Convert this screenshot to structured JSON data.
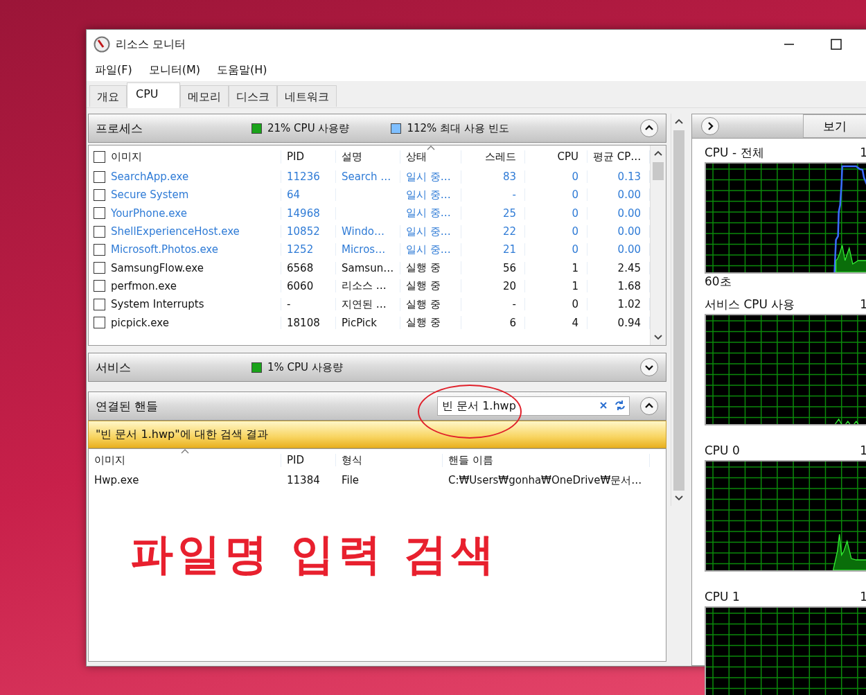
{
  "window": {
    "title": "리소스 모니터"
  },
  "menu": [
    "파일(F)",
    "모니터(M)",
    "도움말(H)"
  ],
  "tabs": [
    {
      "label": "개요",
      "selected": false
    },
    {
      "label": "CPU",
      "selected": true
    },
    {
      "label": "메모리",
      "selected": false
    },
    {
      "label": "디스크",
      "selected": false
    },
    {
      "label": "네트워크",
      "selected": false
    }
  ],
  "processes": {
    "title": "프로세스",
    "expanded": true,
    "legend": [
      {
        "text": "21% CPU 사용량",
        "color": "#1aa31a"
      },
      {
        "text": "112% 최대 사용 빈도",
        "color": "#7fbfff"
      }
    ],
    "columns": [
      "이미지",
      "PID",
      "설명",
      "상태",
      "스레드",
      "CPU",
      "평균 CP…"
    ],
    "all_checked": false,
    "rows": [
      {
        "cells": [
          "SearchApp.exe",
          "11236",
          "Search …",
          "일시 중…",
          "83",
          "0",
          "0.13"
        ],
        "suspended": true,
        "checked": false
      },
      {
        "cells": [
          "Secure System",
          "64",
          "",
          "일시 중…",
          "-",
          "0",
          "0.00"
        ],
        "suspended": true,
        "checked": false
      },
      {
        "cells": [
          "YourPhone.exe",
          "14968",
          "",
          "일시 중…",
          "25",
          "0",
          "0.00"
        ],
        "suspended": true,
        "checked": false
      },
      {
        "cells": [
          "ShellExperienceHost.exe",
          "10852",
          "Windo…",
          "일시 중…",
          "22",
          "0",
          "0.00"
        ],
        "suspended": true,
        "checked": false
      },
      {
        "cells": [
          "Microsoft.Photos.exe",
          "1252",
          "Micros…",
          "일시 중…",
          "21",
          "0",
          "0.00"
        ],
        "suspended": true,
        "checked": false
      },
      {
        "cells": [
          "SamsungFlow.exe",
          "6568",
          "Samsun…",
          "실행 중",
          "56",
          "1",
          "2.45"
        ],
        "suspended": false,
        "checked": false
      },
      {
        "cells": [
          "perfmon.exe",
          "6060",
          "리소스 …",
          "실행 중",
          "20",
          "1",
          "1.68"
        ],
        "suspended": false,
        "checked": false
      },
      {
        "cells": [
          "System Interrupts",
          "-",
          "지연된 …",
          "실행 중",
          "-",
          "0",
          "1.02"
        ],
        "suspended": false,
        "checked": false
      },
      {
        "cells": [
          "picpick.exe",
          "18108",
          "PicPick",
          "실행 중",
          "6",
          "4",
          "0.94"
        ],
        "suspended": false,
        "checked": false
      }
    ]
  },
  "services": {
    "title": "서비스",
    "expanded": false,
    "legend": [
      {
        "text": "1% CPU 사용량",
        "color": "#1aa31a"
      }
    ]
  },
  "handles": {
    "title": "연결된 핸들",
    "expanded": true,
    "search_value": "빈 문서 1.hwp",
    "result_banner": "\"빈 문서 1.hwp\"에 대한 검색 결과",
    "columns": [
      "이미지",
      "PID",
      "형식",
      "핸들 이름"
    ],
    "rows": [
      [
        "Hwp.exe",
        "11384",
        "File",
        "C:₩Users₩gonha₩OneDrive₩문서…"
      ]
    ]
  },
  "annotation": "파일명 입력 검색",
  "right_pane": {
    "view_button": "보기",
    "graphs": [
      {
        "label": "CPU - 전체",
        "max": "1",
        "footer": "60초"
      },
      {
        "label": "서비스 CPU 사용",
        "max": "1"
      },
      {
        "label": "CPU 0",
        "max": "1"
      },
      {
        "label": "CPU 1",
        "max": "1"
      }
    ]
  }
}
